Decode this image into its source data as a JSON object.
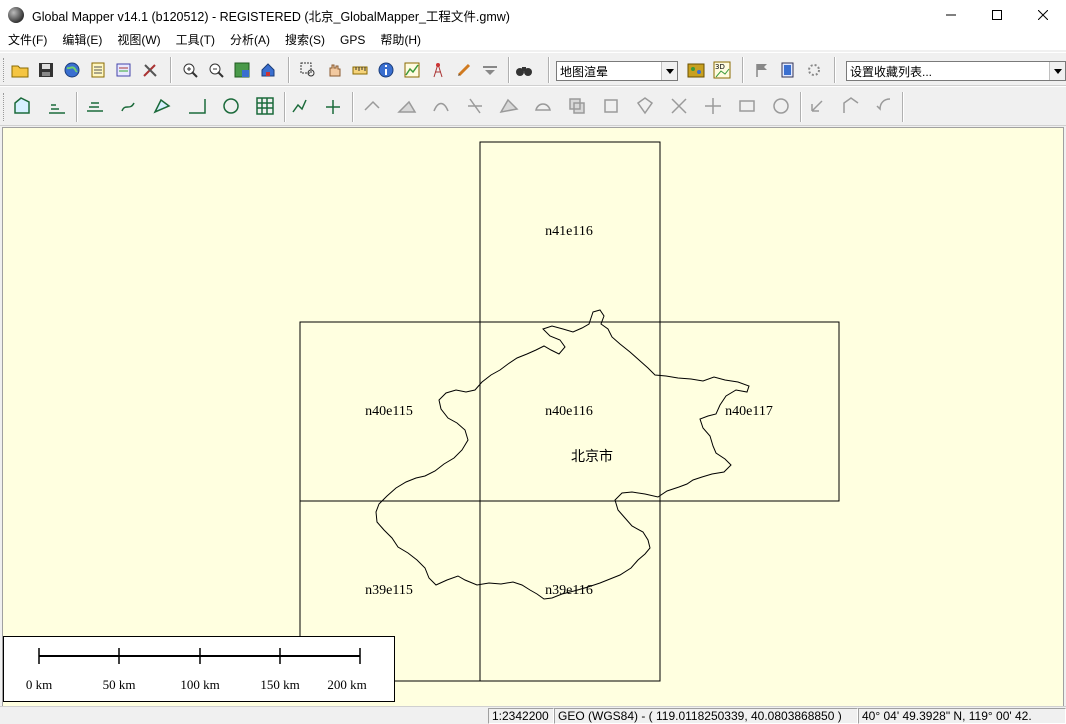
{
  "window": {
    "title": "Global Mapper v14.1 (b120512) - REGISTERED (北京_GlobalMapper_工程文件.gmw)",
    "minimize": "—",
    "maximize": "☐",
    "close": "✕"
  },
  "menu": {
    "items": [
      {
        "label": "文件(F)"
      },
      {
        "label": "编辑(E)"
      },
      {
        "label": "视图(W)"
      },
      {
        "label": "工具(T)"
      },
      {
        "label": "分析(A)"
      },
      {
        "label": "搜索(S)"
      },
      {
        "label": "GPS"
      },
      {
        "label": "帮助(H)"
      }
    ]
  },
  "toolbar": {
    "render_mode": "地图渲晕",
    "bookmarks": "设置收藏列表..."
  },
  "map": {
    "tiles": [
      {
        "label": "n41e116"
      },
      {
        "label": "n40e115"
      },
      {
        "label": "n40e116"
      },
      {
        "label": "n40e117"
      },
      {
        "label": "n39e115"
      },
      {
        "label": "n39e116"
      }
    ],
    "city_label": "北京市",
    "background": "#ffffe0"
  },
  "scalebar": {
    "labels": [
      "0 km",
      "50 km",
      "100 km",
      "150 km",
      "200 km"
    ]
  },
  "status": {
    "scale": "1:2342200",
    "projection": "GEO (WGS84) - ( 119.0118250339, 40.0803868850 )",
    "dms": "40° 04' 49.3928\" N, 119° 00' 42."
  }
}
